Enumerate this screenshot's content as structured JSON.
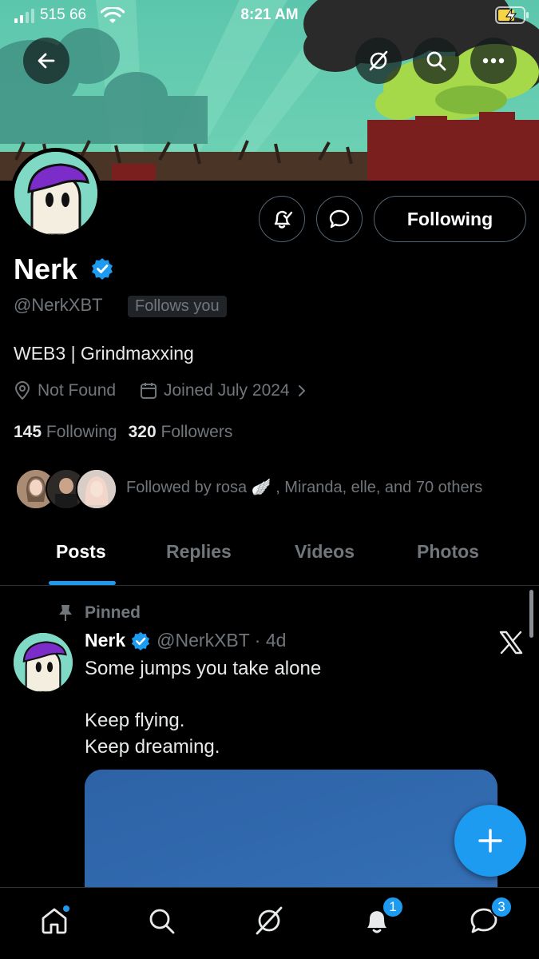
{
  "status_bar": {
    "carrier": "515 66",
    "time": "8:21 AM"
  },
  "header_buttons": {
    "back_icon": "arrow-left-icon",
    "grok_icon": "grok-icon",
    "search_icon": "search-icon",
    "more_icon": "more-horizontal-icon"
  },
  "profile": {
    "name": "Nerk",
    "handle": "@NerkXBT",
    "follows_you": "Follows you",
    "bio": "WEB3 | Grindmaxxing",
    "location": "Not Found",
    "joined": "Joined July 2024",
    "following_count": "145",
    "following_label": "Following",
    "followers_count": "320",
    "followers_label": "Followers",
    "followed_by": "Followed by rosa 🪽 , Miranda, elle, and 70 others",
    "follow_button": "Following"
  },
  "tabs": [
    {
      "label": "Posts",
      "active": true
    },
    {
      "label": "Replies",
      "active": false
    },
    {
      "label": "Videos",
      "active": false
    },
    {
      "label": "Photos",
      "active": false
    }
  ],
  "post": {
    "pinned_label": "Pinned",
    "name": "Nerk",
    "meta": "@NerkXBT · 4d",
    "text": "Some jumps you take alone\n\nKeep flying.\nKeep dreaming."
  },
  "bottom_nav": {
    "notifications_badge": "1",
    "messages_badge": "3"
  },
  "colors": {
    "accent": "#1d9bf0",
    "background": "#000000",
    "muted": "#71767b"
  }
}
